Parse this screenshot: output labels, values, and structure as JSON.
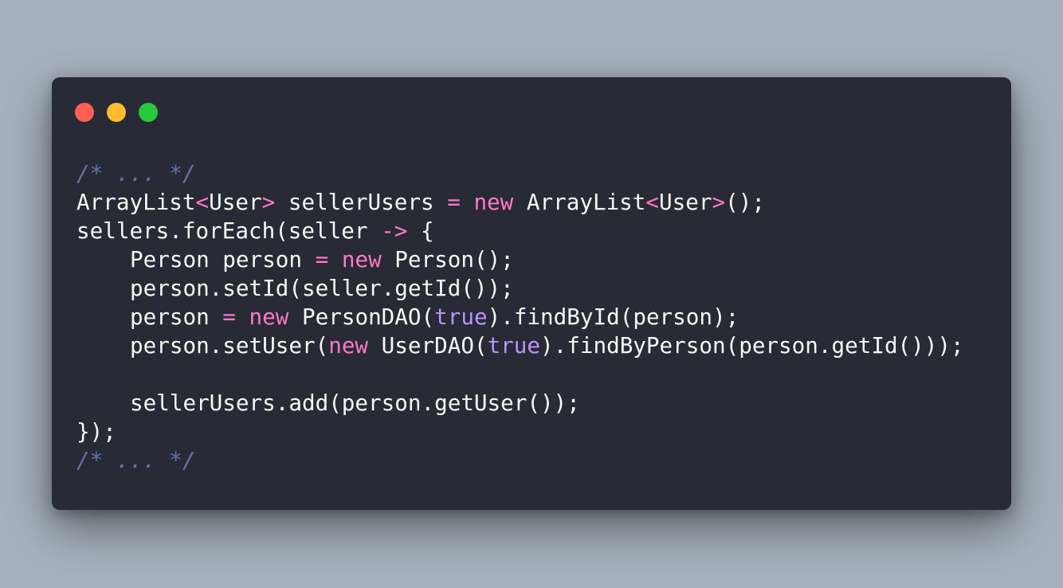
{
  "colors": {
    "background": "#a6b1bd",
    "editor_bg": "#282a36",
    "close": "#ff5f56",
    "minimize": "#ffbd2e",
    "maximize": "#27c93f",
    "plain": "#f8f8f2",
    "keyword": "#ff79c6",
    "constant": "#bd93f9",
    "comment": "#6272a4"
  },
  "window_controls": [
    {
      "name": "close-button",
      "color": "#ff5f56"
    },
    {
      "name": "minimize-button",
      "color": "#ffbd2e"
    },
    {
      "name": "maximize-button",
      "color": "#27c93f"
    }
  ],
  "code_lines": [
    {
      "indent": 0,
      "tokens": [
        {
          "t": "/* ... */",
          "c": "comment"
        }
      ]
    },
    {
      "indent": 0,
      "tokens": [
        {
          "t": "ArrayList",
          "c": "plain"
        },
        {
          "t": "<",
          "c": "keyword"
        },
        {
          "t": "User",
          "c": "plain"
        },
        {
          "t": ">",
          "c": "keyword"
        },
        {
          "t": " sellerUsers ",
          "c": "plain"
        },
        {
          "t": "=",
          "c": "keyword"
        },
        {
          "t": " ",
          "c": "plain"
        },
        {
          "t": "new",
          "c": "keyword"
        },
        {
          "t": " ArrayList",
          "c": "plain"
        },
        {
          "t": "<",
          "c": "keyword"
        },
        {
          "t": "User",
          "c": "plain"
        },
        {
          "t": ">",
          "c": "keyword"
        },
        {
          "t": "();",
          "c": "plain"
        }
      ]
    },
    {
      "indent": 0,
      "tokens": [
        {
          "t": "sellers.forEach(seller ",
          "c": "plain"
        },
        {
          "t": "->",
          "c": "keyword"
        },
        {
          "t": " {",
          "c": "plain"
        }
      ]
    },
    {
      "indent": 1,
      "tokens": [
        {
          "t": "Person person ",
          "c": "plain"
        },
        {
          "t": "=",
          "c": "keyword"
        },
        {
          "t": " ",
          "c": "plain"
        },
        {
          "t": "new",
          "c": "keyword"
        },
        {
          "t": " Person();",
          "c": "plain"
        }
      ]
    },
    {
      "indent": 1,
      "tokens": [
        {
          "t": "person.setId(seller.getId());",
          "c": "plain"
        }
      ]
    },
    {
      "indent": 1,
      "tokens": [
        {
          "t": "person ",
          "c": "plain"
        },
        {
          "t": "=",
          "c": "keyword"
        },
        {
          "t": " ",
          "c": "plain"
        },
        {
          "t": "new",
          "c": "keyword"
        },
        {
          "t": " PersonDAO(",
          "c": "plain"
        },
        {
          "t": "true",
          "c": "constant"
        },
        {
          "t": ").findById(person);",
          "c": "plain"
        }
      ]
    },
    {
      "indent": 1,
      "tokens": [
        {
          "t": "person.setUser(",
          "c": "plain"
        },
        {
          "t": "new",
          "c": "keyword"
        },
        {
          "t": " UserDAO(",
          "c": "plain"
        },
        {
          "t": "true",
          "c": "constant"
        },
        {
          "t": ").findByPerson(person.getId()));",
          "c": "plain"
        }
      ]
    },
    {
      "indent": 0,
      "tokens": []
    },
    {
      "indent": 1,
      "tokens": [
        {
          "t": "sellerUsers.add(person.getUser());",
          "c": "plain"
        }
      ]
    },
    {
      "indent": 0,
      "tokens": [
        {
          "t": "});",
          "c": "plain"
        }
      ]
    },
    {
      "indent": 0,
      "tokens": [
        {
          "t": "/* ... */",
          "c": "comment"
        }
      ]
    }
  ]
}
